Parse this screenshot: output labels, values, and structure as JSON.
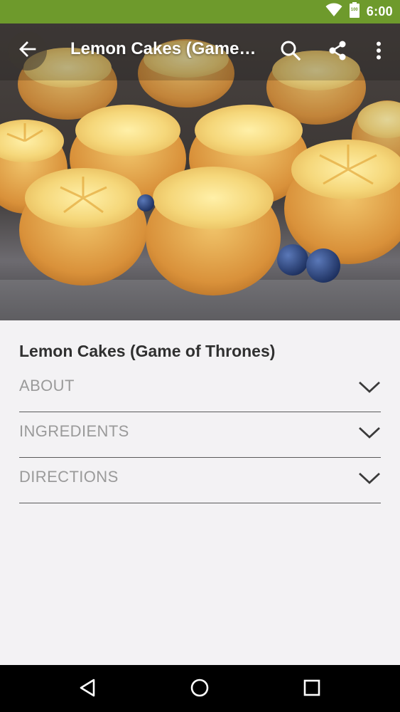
{
  "status_bar": {
    "time": "6:00",
    "battery_label": "100",
    "color": "#6e9a2c"
  },
  "toolbar": {
    "title": "Lemon Cakes (Game of Thrones)",
    "icons": [
      "arrow-back-icon",
      "search-icon",
      "share-icon",
      "more-vert-icon"
    ]
  },
  "hero": {
    "description_icon": "food-photo"
  },
  "recipe": {
    "title": "Lemon Cakes (Game of Thrones)",
    "sections": [
      {
        "label": "ABOUT"
      },
      {
        "label": "INGREDIENTS"
      },
      {
        "label": "DIRECTIONS"
      }
    ]
  },
  "nav": {
    "icons": [
      "back-triangle-icon",
      "home-circle-icon",
      "recents-square-icon"
    ]
  }
}
